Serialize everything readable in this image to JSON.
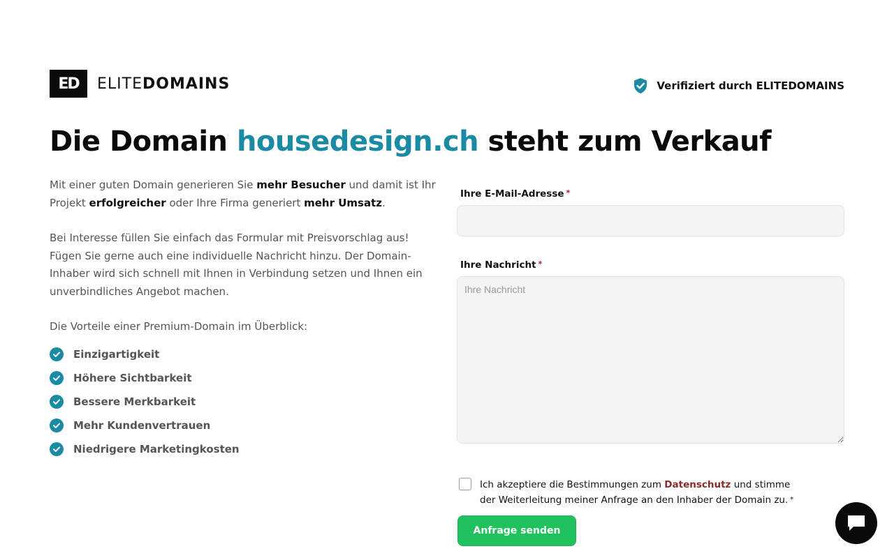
{
  "brand": {
    "mark": "ED",
    "name_light": "ELITE",
    "name_bold": "DOMAINS"
  },
  "verified": {
    "text": "Verifiziert durch ELITEDOMAINS",
    "icon": "shield-check-icon",
    "color": "#1a8aa5"
  },
  "headline": {
    "prefix": "Die Domain ",
    "domain": "housedesign.ch",
    "suffix": " steht zum Verkauf"
  },
  "intro": {
    "p1_a": "Mit einer guten Domain generieren Sie ",
    "p1_b": "mehr Besucher",
    "p1_c": " und damit ist Ihr Projekt ",
    "p1_d": "erfolgreicher",
    "p1_e": " oder Ihre Firma generiert ",
    "p1_f": "mehr Umsatz",
    "p1_g": ".",
    "p2": "Bei Interesse füllen Sie einfach das Formular mit Preisvorschlag aus! Fügen Sie gerne auch eine individuelle Nachricht hinzu. Der Domain-Inhaber wird sich schnell mit Ihnen in Verbindung setzen und Ihnen ein unverbindliches Angebot machen.",
    "benefits_intro": "Die Vorteile einer Premium-Domain im Überblick:"
  },
  "benefits": [
    "Einzigartigkeit",
    "Höhere Sichtbarkeit",
    "Bessere Merkbarkeit",
    "Mehr Kundenvertrauen",
    "Niedrigere Marketingkosten"
  ],
  "form": {
    "email_label": "Ihre E-Mail-Adresse",
    "email_value": "",
    "email_placeholder": "",
    "message_label": "Ihre Nachricht",
    "message_placeholder": "Ihre Nachricht",
    "required_mark": "*",
    "consent_a": "Ich akzeptiere die Bestimmungen zum ",
    "consent_link": "Datenschutz",
    "consent_b": " und stimme der Weiterleitung meiner Anfrage an den Inhaber der Domain zu.",
    "submit_label": "Anfrage senden"
  },
  "colors": {
    "accent": "#1a8aa5",
    "submit": "#21c25d",
    "link": "#8a2a2a"
  },
  "chat": {
    "icon": "chat-bubble-icon"
  }
}
